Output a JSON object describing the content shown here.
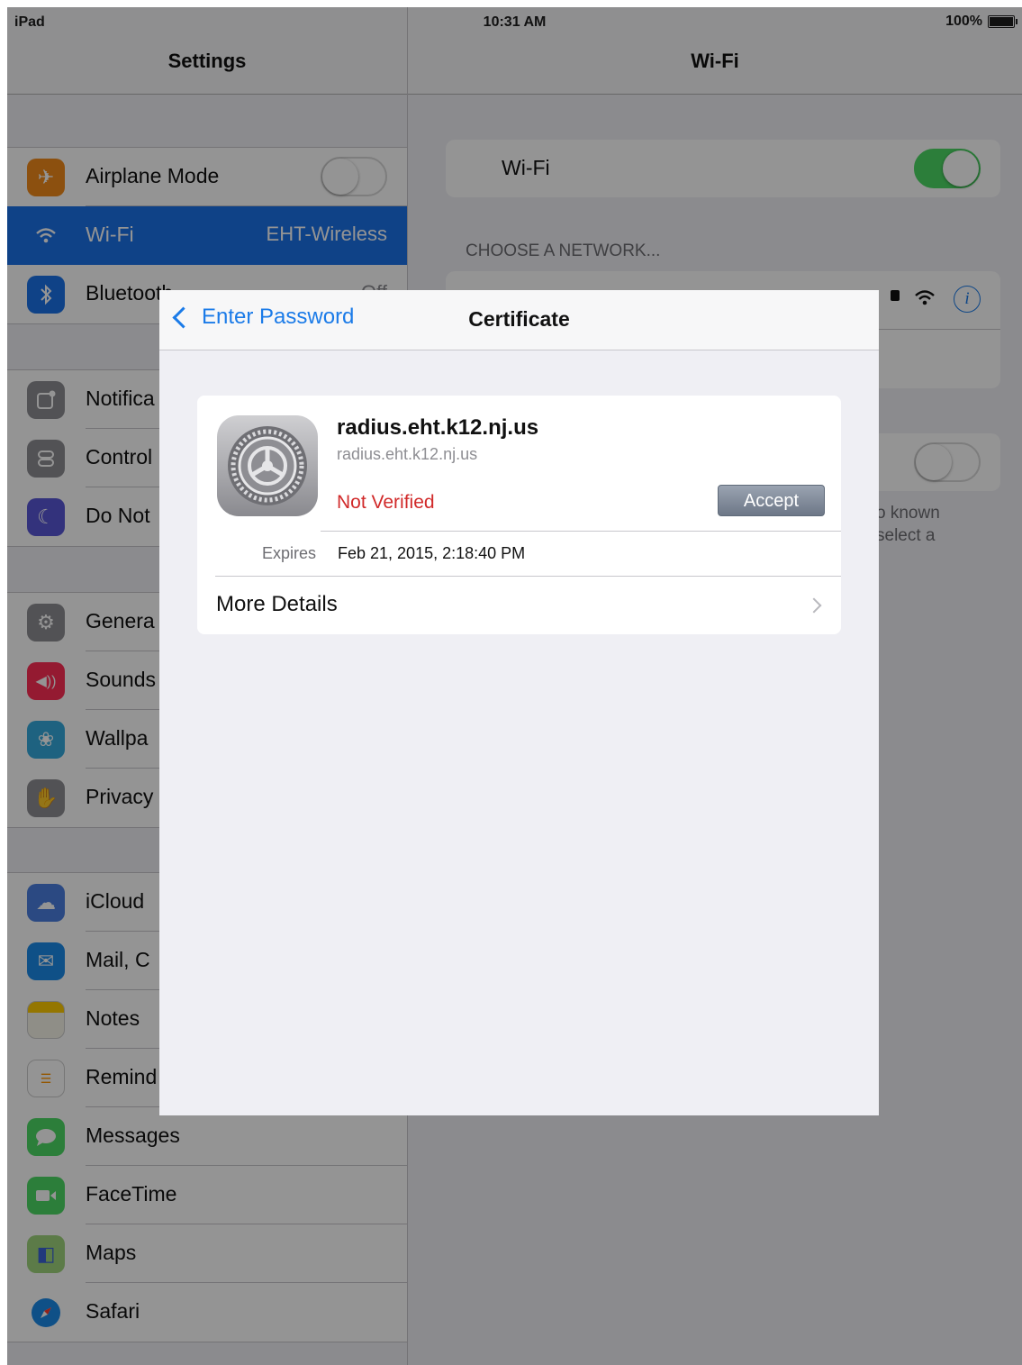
{
  "status": {
    "device": "iPad",
    "time": "10:31 AM",
    "battery": "100%"
  },
  "settings": {
    "title": "Settings",
    "group1": [
      {
        "label": "Airplane Mode",
        "icon": "airplane-icon",
        "color": "#f28b1b"
      },
      {
        "label": "Wi-Fi",
        "value": "EHT-Wireless",
        "icon": "wifi-icon",
        "color": "#1b73e8"
      },
      {
        "label": "Bluetooth",
        "value": "Off",
        "icon": "bluetooth-icon",
        "color": "#1b73e8"
      }
    ],
    "group2": [
      {
        "label": "Notifica",
        "icon": "notifications-icon",
        "color": "#8e8e93"
      },
      {
        "label": "Control",
        "icon": "control-center-icon",
        "color": "#8e8e93"
      },
      {
        "label": "Do Not",
        "icon": "moon-icon",
        "color": "#5856d6"
      }
    ],
    "group3": [
      {
        "label": "Genera",
        "icon": "gear-icon",
        "color": "#8e8e93"
      },
      {
        "label": "Sounds",
        "icon": "speaker-icon",
        "color": "#ff2d55"
      },
      {
        "label": "Wallpa",
        "icon": "wallpaper-icon",
        "color": "#34aadc"
      },
      {
        "label": "Privacy",
        "icon": "hand-icon",
        "color": "#8e8e93"
      }
    ],
    "group4": [
      {
        "label": "iCloud",
        "icon": "cloud-icon",
        "color": "#4a7fe0"
      },
      {
        "label": "Mail, C",
        "icon": "mail-icon",
        "color": "#1b8ae8"
      },
      {
        "label": "Notes",
        "icon": "notes-icon",
        "color": "#ffcc00"
      },
      {
        "label": "Remind",
        "icon": "list-icon",
        "color": "#ffffff"
      },
      {
        "label": "Messages",
        "icon": "messages-icon",
        "color": "#4cd964"
      },
      {
        "label": "FaceTime",
        "icon": "video-icon",
        "color": "#4cd964"
      },
      {
        "label": "Maps",
        "icon": "map-icon",
        "color": "#9fd47c"
      },
      {
        "label": "Safari",
        "icon": "compass-icon",
        "color": "#1b8ae8"
      }
    ]
  },
  "wifi": {
    "title": "Wi-Fi",
    "toggle_label": "Wi-Fi",
    "choose_header": "CHOOSE A NETWORK...",
    "footnote_line1": "o known",
    "footnote_line2": "select a"
  },
  "modal": {
    "back_label": "Enter Password",
    "title": "Certificate",
    "cert_name": "radius.eht.k12.nj.us",
    "cert_issuer": "radius.eht.k12.nj.us",
    "status": "Not Verified",
    "accept_label": "Accept",
    "expires_label": "Expires",
    "expires_value": "Feb 21, 2015, 2:18:40 PM",
    "more_details": "More Details"
  }
}
